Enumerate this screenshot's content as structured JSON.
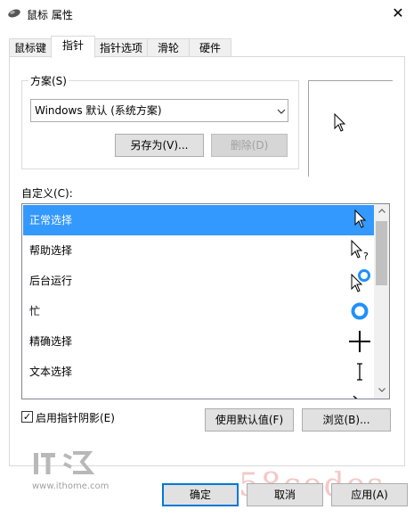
{
  "window": {
    "title": "鼠标 属性",
    "close_glyph": "✕"
  },
  "tabs": [
    {
      "label": "鼠标键",
      "active": false
    },
    {
      "label": "指针",
      "active": true
    },
    {
      "label": "指针选项",
      "active": false
    },
    {
      "label": "滑轮",
      "active": false
    },
    {
      "label": "硬件",
      "active": false
    }
  ],
  "scheme": {
    "label": "方案(S)",
    "selected": "Windows 默认 (系统方案)",
    "save_as": "另存为(V)...",
    "delete": "删除(D)"
  },
  "customize": {
    "label": "自定义(C):",
    "items": [
      {
        "label": "正常选择",
        "icon": "arrow-cursor-icon",
        "selected": true
      },
      {
        "label": "帮助选择",
        "icon": "help-cursor-icon",
        "selected": false
      },
      {
        "label": "后台运行",
        "icon": "working-in-background-cursor-icon",
        "selected": false
      },
      {
        "label": "忙",
        "icon": "busy-cursor-icon",
        "selected": false
      },
      {
        "label": "精确选择",
        "icon": "crosshair-cursor-icon",
        "selected": false
      },
      {
        "label": "文本选择",
        "icon": "text-select-cursor-icon",
        "selected": false
      },
      {
        "label": "",
        "icon": "handwriting-cursor-icon",
        "selected": false
      }
    ]
  },
  "options": {
    "shadow_label": "启用指针阴影(E)",
    "shadow_checked": true,
    "check_glyph": "✓",
    "use_default": "使用默认值(F)",
    "browse": "浏览(B)..."
  },
  "footer": {
    "ok": "确定",
    "cancel": "取消",
    "apply": "应用(A)"
  },
  "watermark": {
    "logo_text": "IT之家",
    "url": "www.ithome.com",
    "brand": "58codes"
  },
  "colors": {
    "selection": "#3399ff",
    "default_button_border": "#0078d7"
  }
}
